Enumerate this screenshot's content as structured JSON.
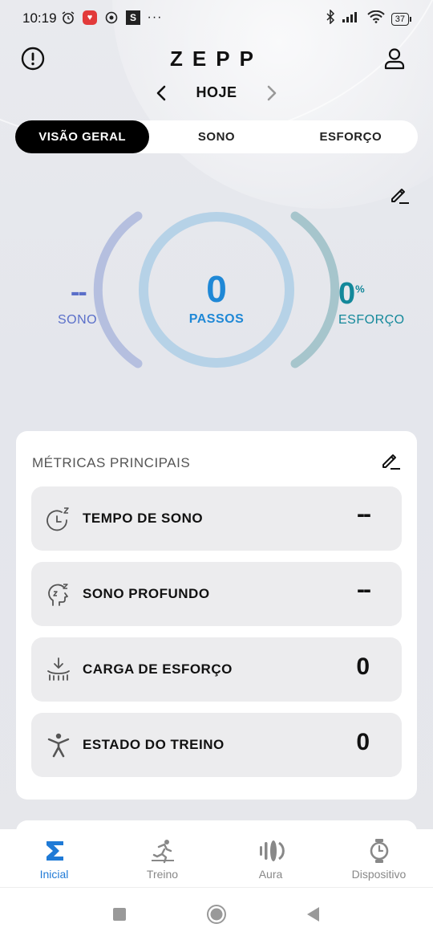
{
  "status_bar": {
    "time": "10:19",
    "battery": "37",
    "more_dots": "···"
  },
  "header": {
    "logo": "ZEPP",
    "date_label": "HOJE"
  },
  "tabs": [
    {
      "label": "VISÃO GERAL",
      "active": true
    },
    {
      "label": "SONO",
      "active": false
    },
    {
      "label": "ESFORÇO",
      "active": false
    }
  ],
  "summary": {
    "steps_value": "0",
    "steps_label": "PASSOS",
    "sleep_value": "--",
    "sleep_label": "SONO",
    "effort_value": "0",
    "effort_unit": "%",
    "effort_label": "ESFORÇO"
  },
  "metrics": {
    "title": "MÉTRICAS PRINCIPAIS",
    "items": [
      {
        "label": "TEMPO DE SONO",
        "value": "--",
        "icon": "sleep-clock-icon"
      },
      {
        "label": "SONO PROFUNDO",
        "value": "--",
        "icon": "deep-sleep-head-icon"
      },
      {
        "label": "CARGA DE ESFORÇO",
        "value": "0",
        "icon": "effort-load-icon"
      },
      {
        "label": "ESTADO DO TREINO",
        "value": "0",
        "icon": "training-status-icon"
      }
    ]
  },
  "bottom_nav": [
    {
      "label": "Inicial",
      "active": true
    },
    {
      "label": "Treino",
      "active": false
    },
    {
      "label": "Aura",
      "active": false
    },
    {
      "label": "Dispositivo",
      "active": false
    }
  ],
  "colors": {
    "steps": "#1f88d6",
    "sleep": "#5a6fc9",
    "effort": "#13889a",
    "active_nav": "#1f7ad6"
  }
}
